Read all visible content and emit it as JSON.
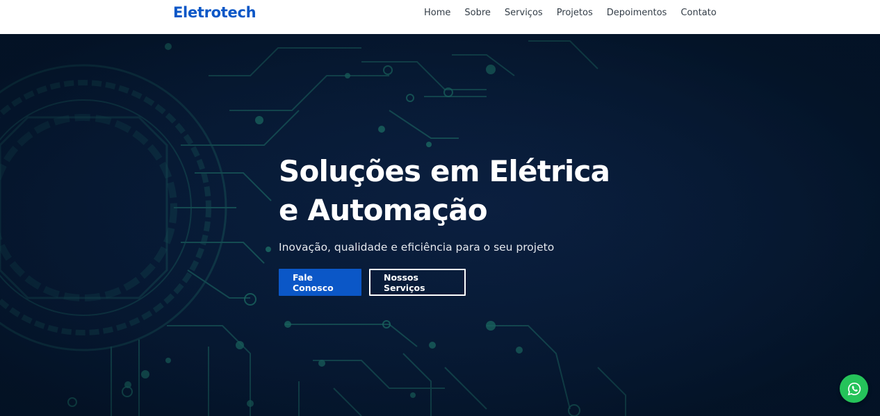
{
  "brand": {
    "name": "Eletrotech",
    "color": "#0b57c7"
  },
  "nav": {
    "items": [
      {
        "label": "Home"
      },
      {
        "label": "Sobre"
      },
      {
        "label": "Serviços"
      },
      {
        "label": "Projetos"
      },
      {
        "label": "Depoimentos"
      },
      {
        "label": "Contato"
      }
    ]
  },
  "hero": {
    "title_line1": "Soluções em Elétrica",
    "title_line2": "e Automação",
    "subtitle": "Inovação, qualidade e eficiência para o seu projeto",
    "primary_button": "Fale Conosco",
    "secondary_button": "Nossos Serviços",
    "background_theme": "dark-blue-circuit-board"
  },
  "floating": {
    "whatsapp_icon": "whatsapp-icon",
    "color": "#25c35a"
  }
}
